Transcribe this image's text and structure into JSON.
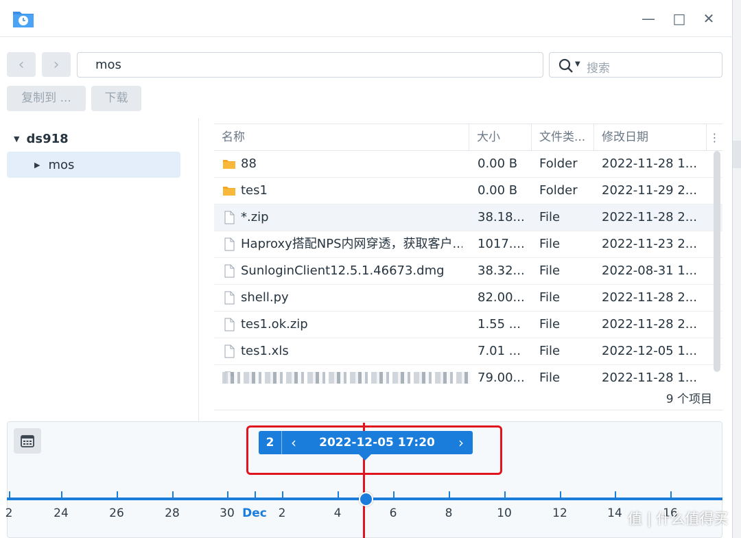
{
  "window": {
    "app_icon": "file-station-clock-icon",
    "controls": {
      "minimize": "—",
      "maximize": "□",
      "close": "✕"
    }
  },
  "toolbar": {
    "back_icon": "chevron-left-icon",
    "forward_icon": "chevron-right-icon",
    "path": "mos",
    "search_placeholder": "搜索",
    "copy_to_label": "复制到 ...",
    "download_label": "下载"
  },
  "sidebar": {
    "root_label": "ds918",
    "items": [
      {
        "label": "mos"
      }
    ]
  },
  "table": {
    "columns": [
      "名称",
      "大小",
      "文件类...",
      "修改日期"
    ],
    "rows": [
      {
        "name": "88",
        "size": "0.00 B",
        "type": "Folder",
        "modified": "2022-11-28 1...",
        "icon": "folder-icon"
      },
      {
        "name": "tes1",
        "size": "0.00 B",
        "type": "Folder",
        "modified": "2022-11-29 2...",
        "icon": "folder-icon"
      },
      {
        "name": "*.zip",
        "size": "38.18...",
        "type": "File",
        "modified": "2022-11-28 2...",
        "icon": "file-icon",
        "selected": true
      },
      {
        "name": "Haproxy搭配NPS内网穿透，获取客户...",
        "size": "1017....",
        "type": "File",
        "modified": "2022-11-23 2...",
        "icon": "file-icon"
      },
      {
        "name": "SunloginClient12.5.1.46673.dmg",
        "size": "38.32...",
        "type": "File",
        "modified": "2022-08-31 1...",
        "icon": "file-icon"
      },
      {
        "name": "shell.py",
        "size": "82.00...",
        "type": "File",
        "modified": "2022-11-28 2...",
        "icon": "file-icon"
      },
      {
        "name": "tes1.ok.zip",
        "size": "1.55 ...",
        "type": "File",
        "modified": "2022-11-28 2...",
        "icon": "file-icon"
      },
      {
        "name": "tes1.xls",
        "size": "7.01 ...",
        "type": "File",
        "modified": "2022-12-05 1...",
        "icon": "file-icon"
      },
      {
        "name": "",
        "size": "79.00...",
        "type": "File",
        "modified": "2022-11-28 1...",
        "icon": "file-icon",
        "blurred": true
      }
    ],
    "item_count": "9 个项目"
  },
  "timeline": {
    "calendar_icon": "calendar-icon",
    "version_number": "2",
    "prev_icon": "chevron-left-icon",
    "next_icon": "chevron-right-icon",
    "datetime": "2022-12-05 17:20",
    "ticks": [
      "2",
      "24",
      "26",
      "28",
      "30",
      "Dec",
      "2",
      "4",
      "6",
      "8",
      "10",
      "12",
      "14",
      "16"
    ],
    "accent_color": "#1a7ddb",
    "highlight_color": "#e0141e"
  },
  "watermark": "值 | 什么值得买"
}
